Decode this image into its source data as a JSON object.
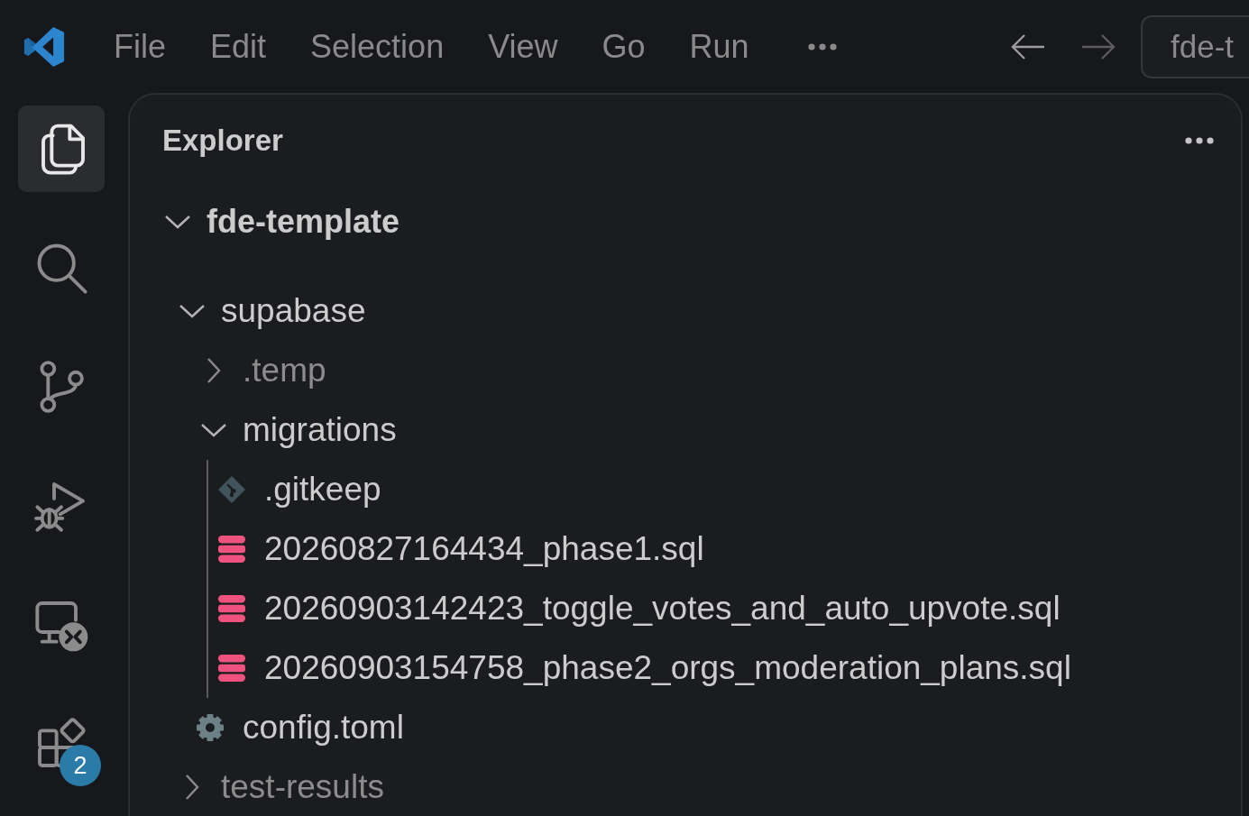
{
  "title_bar": {
    "menu": [
      "File",
      "Edit",
      "Selection",
      "View",
      "Go",
      "Run"
    ],
    "navigation": {
      "back": {
        "disabled": false
      },
      "forward": {
        "disabled": true
      }
    },
    "command_center": {
      "label": "fde-t"
    }
  },
  "activity_bar": {
    "items": [
      {
        "kind": "explorer",
        "selected": true
      },
      {
        "kind": "search",
        "selected": false
      },
      {
        "kind": "scm",
        "selected": false
      },
      {
        "kind": "debug",
        "selected": false
      },
      {
        "kind": "remote",
        "selected": false
      },
      {
        "kind": "extensions",
        "selected": false,
        "badge": "2"
      }
    ]
  },
  "explorer": {
    "title": "Explorer",
    "tree": {
      "label": "fde-template",
      "kind": "folder",
      "expanded": true,
      "dimmed": false,
      "guide": false,
      "children": [
        {
          "label": "supabase",
          "kind": "folder",
          "expanded": true,
          "dimmed": false,
          "guide": false,
          "children": [
            {
              "label": ".temp",
              "kind": "folder",
              "expanded": false,
              "dimmed": true
            },
            {
              "label": "migrations",
              "kind": "folder",
              "expanded": true,
              "dimmed": false,
              "guide": true,
              "children": [
                {
                  "label": ".gitkeep",
                  "kind": "gitkeep",
                  "dimmed": false
                },
                {
                  "label": "20260827164434_phase1.sql",
                  "kind": "sql",
                  "dimmed": false
                },
                {
                  "label": "20260903142423_toggle_votes_and_auto_upvote.sql",
                  "kind": "sql",
                  "dimmed": false
                },
                {
                  "label": "20260903154758_phase2_orgs_moderation_plans.sql",
                  "kind": "sql",
                  "dimmed": false
                }
              ]
            },
            {
              "label": "config.toml",
              "kind": "toml",
              "dimmed": false
            }
          ]
        },
        {
          "label": "test-results",
          "kind": "folder",
          "expanded": false,
          "dimmed": true
        }
      ]
    }
  }
}
